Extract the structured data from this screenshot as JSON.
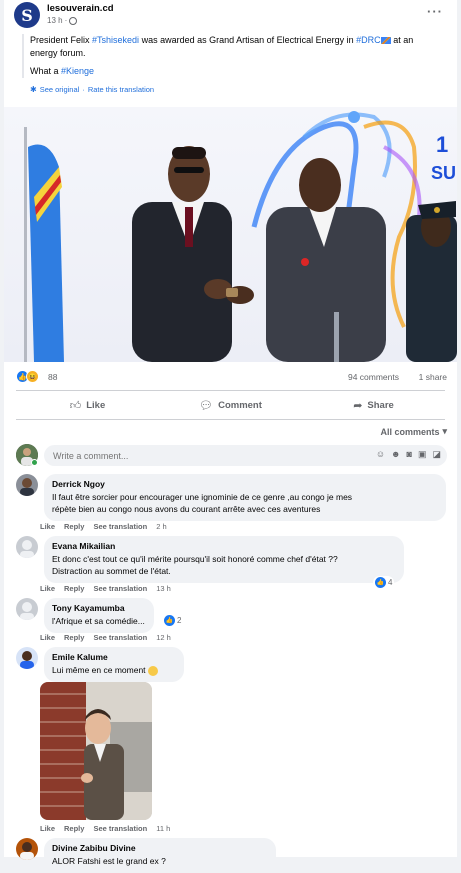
{
  "post": {
    "page_name": "lesouverain.cd",
    "page_initial": "S",
    "time": "13 h",
    "text_parts": [
      "President Felix ",
      "#Tshisekedi",
      " was awarded as Grand Artisan of Electrical Energy in ",
      "#DRC",
      " at an energy forum."
    ],
    "text_line2": [
      "What a ",
      "#Kienge"
    ],
    "see_original": "See original",
    "rate_translation": "Rate this translation",
    "separator": "·"
  },
  "reactions": {
    "count": "88",
    "comments": "94 comments",
    "shares": "1 share"
  },
  "actions": {
    "like": "Like",
    "comment": "Comment",
    "share": "Share"
  },
  "filter": {
    "label": "All comments"
  },
  "composer": {
    "placeholder": "Write a comment..."
  },
  "comment_actions": {
    "like": "Like",
    "reply": "Reply",
    "see_translation": "See translation"
  },
  "comments": [
    {
      "name": "Derrick Ngoy",
      "text_lines": [
        "Il faut être sorcier pour encourager une ignominie de ce genre ,au congo je mes",
        "répète bien au congo nous avons du courant arrête avec ces aventures"
      ],
      "time": "2 h"
    },
    {
      "name": "Evana Mikailian",
      "text_lines": [
        "Et donc c'est tout ce qu'il mérite poursqu'il soit honoré comme chef d'état ??",
        "Distraction au sommet de l'état."
      ],
      "time": "13 h",
      "likes": "4"
    },
    {
      "name": "Tony Kayamumba",
      "text_lines": [
        "l'Afrique et sa comédie..."
      ],
      "time": "12 h",
      "likes": "2"
    },
    {
      "name": "Emile Kalume",
      "text_lines": [
        "Lui même en ce moment"
      ],
      "time": "11 h"
    },
    {
      "name": "Divine Zabibu Divine",
      "text_lines": [
        "ALOR Fatshi est le grand ex ?"
      ]
    }
  ],
  "colors": {
    "link": "#216fdb",
    "like_blue": "#1877f2",
    "online": "#31a24c"
  },
  "icons": [
    "globe-icon",
    "more-icon",
    "gear-icon",
    "like-icon",
    "comment-icon",
    "share-icon",
    "chevron-down-icon",
    "emoji-icon",
    "camera-icon",
    "gif-icon",
    "sticker-icon"
  ]
}
